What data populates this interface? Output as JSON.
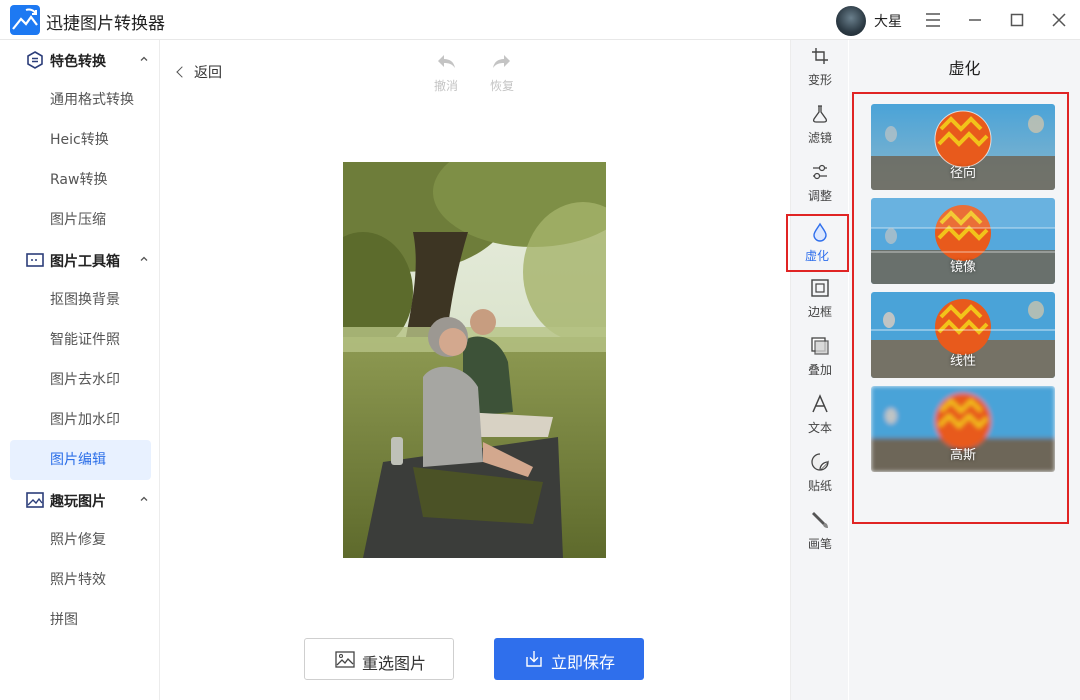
{
  "app": {
    "title": "迅捷图片转换器",
    "username": "大星"
  },
  "sidebar": {
    "groups": [
      {
        "label": "特色转换",
        "items": [
          "通用格式转换",
          "Heic转换",
          "Raw转换",
          "图片压缩"
        ]
      },
      {
        "label": "图片工具箱",
        "items": [
          "抠图换背景",
          "智能证件照",
          "图片去水印",
          "图片加水印",
          "图片编辑"
        ]
      },
      {
        "label": "趣玩图片",
        "items": [
          "照片修复",
          "照片特效",
          "拼图"
        ]
      }
    ],
    "active_item": "图片编辑"
  },
  "editor": {
    "back_label": "返回",
    "undo_label": "撤消",
    "redo_label": "恢复",
    "reselect_label": "重选图片",
    "save_label": "立即保存"
  },
  "tools": [
    "变形",
    "滤镜",
    "调整",
    "虚化",
    "边框",
    "叠加",
    "文本",
    "贴纸",
    "画笔"
  ],
  "active_tool": "虚化",
  "panel": {
    "title": "虚化",
    "effects": [
      "径向",
      "镜像",
      "线性",
      "高斯"
    ]
  },
  "colors": {
    "accent": "#2f6fec",
    "highlight": "#e02424",
    "active_bg": "#e8f1ff"
  }
}
